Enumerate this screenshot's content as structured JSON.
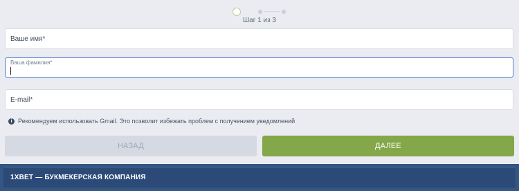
{
  "stepper": {
    "label": "Шаг 1 из 3",
    "current": 1,
    "total": 3
  },
  "form": {
    "first_name": {
      "placeholder": "Ваше имя*",
      "value": ""
    },
    "last_name": {
      "floating_label": "Ваша фамилия*",
      "value": "",
      "focused": true
    },
    "email": {
      "placeholder": "E-mail*",
      "value": ""
    },
    "hint": "Рекомендуем использовать Gmail. Это позволит избежать проблем с получением уведомлений",
    "info_icon": "info-icon"
  },
  "buttons": {
    "back_label": "Назад",
    "next_label": "Далее"
  },
  "footer": {
    "title": "1XBET — БУКМЕКЕРСКАЯ КОМПАНИЯ"
  },
  "colors": {
    "primary": "#83a749",
    "footer": "#2b4a78",
    "focus": "#4c7bd3"
  }
}
